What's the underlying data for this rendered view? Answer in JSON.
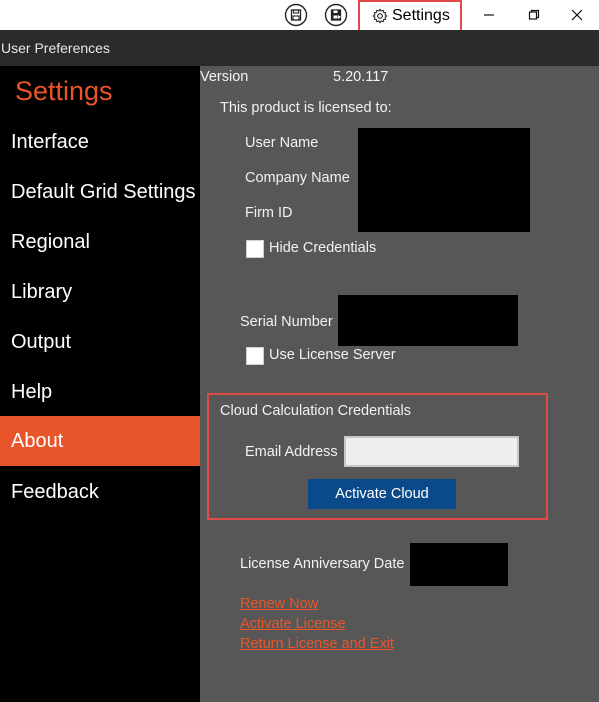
{
  "titlebar": {
    "settings_label": "Settings"
  },
  "header": {
    "title": "User Preferences"
  },
  "sidebar": {
    "title": "Settings",
    "items": [
      {
        "label": "Interface"
      },
      {
        "label": "Default Grid Settings"
      },
      {
        "label": "Regional"
      },
      {
        "label": "Library"
      },
      {
        "label": "Output"
      },
      {
        "label": "Help"
      },
      {
        "label": "About",
        "active": true
      },
      {
        "label": "Feedback"
      }
    ]
  },
  "about": {
    "version_label": "Version",
    "version_value": "5.20.117",
    "licensed_to": "This product is licensed to:",
    "user_name_label": "User Name",
    "company_name_label": "Company Name",
    "firm_id_label": "Firm ID",
    "hide_credentials_label": "Hide Credentials",
    "serial_number_label": "Serial Number",
    "use_license_server_label": "Use License Server",
    "cloud_title": "Cloud Calculation Credentials",
    "email_label": "Email Address",
    "email_value": "",
    "activate_cloud_label": "Activate Cloud",
    "license_anniversary_label": "License Anniversary Date",
    "renew_now": "Renew Now",
    "activate_license": "Activate License",
    "return_license": "Return License and Exit"
  },
  "colors": {
    "accent": "#e9552a",
    "highlight_border": "#e04a48",
    "button_blue": "#0b4a8a",
    "content_bg": "#575757"
  }
}
